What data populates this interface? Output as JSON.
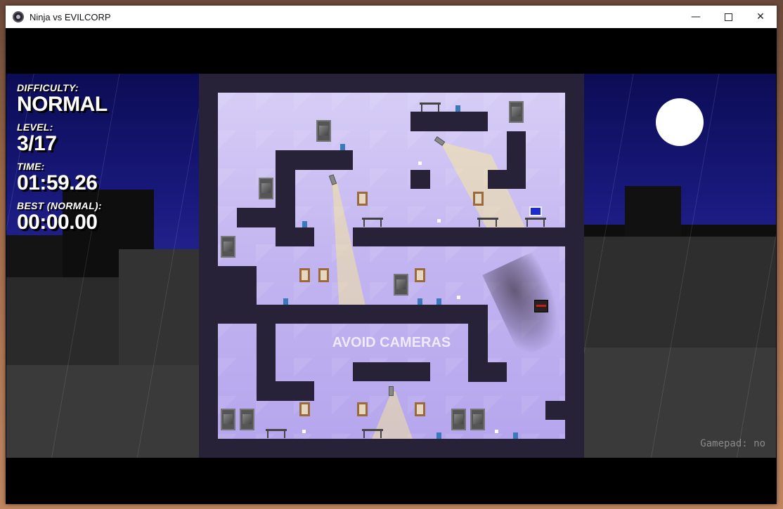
{
  "window": {
    "title": "Ninja vs EVILCORP",
    "controls": {
      "minimize": "—",
      "close": "✕"
    }
  },
  "hud": {
    "difficulty_label": "DIFFICULTY:",
    "difficulty_value": "NORMAL",
    "level_label": "LEVEL:",
    "level_value": "3/17",
    "time_label": "TIME:",
    "time_value": "01:59.26",
    "best_label": "BEST (NORMAL):",
    "best_value": "00:00.00"
  },
  "level": {
    "hint": "AVOID CAMERAS"
  },
  "status": {
    "gamepad": "Gamepad: no"
  },
  "colors": {
    "sky": "#1a1a80",
    "building_dark": "#272238",
    "interior": "#c2b4f0",
    "camera_cone": "#fff08c"
  },
  "icons": [
    "app-icon",
    "minimize-icon",
    "maximize-icon",
    "close-icon",
    "moon-icon",
    "ninja-icon",
    "camera-icon"
  ]
}
